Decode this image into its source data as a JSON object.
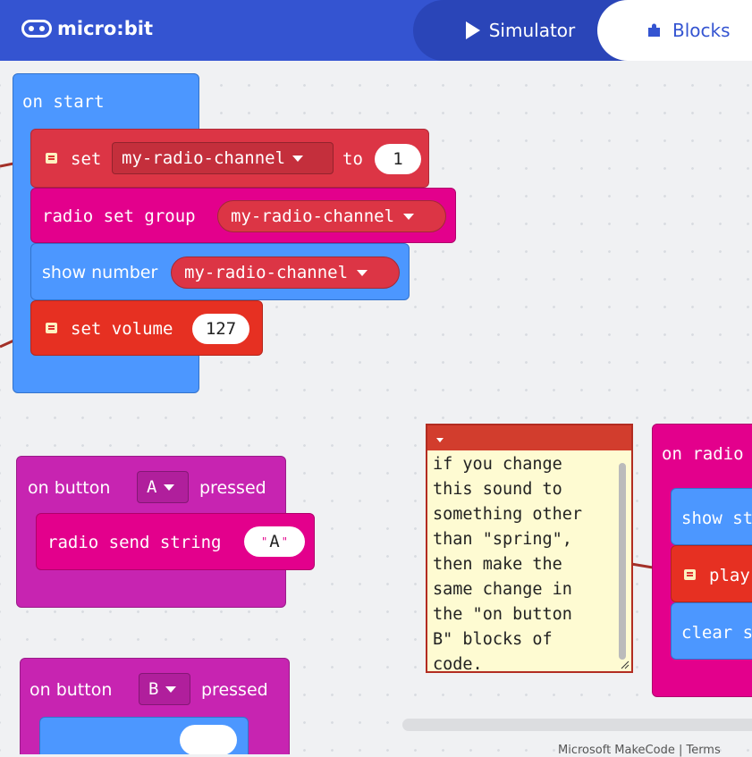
{
  "header": {
    "logo_text": "micro:bit",
    "tabs": [
      {
        "label": "Simulator",
        "icon": "play-icon"
      },
      {
        "label": "Blocks",
        "icon": "puzzle-icon"
      }
    ]
  },
  "blocks": {
    "on_start": {
      "label": "on start",
      "set_var": {
        "set": "set",
        "var": "my-radio-channel",
        "to": "to",
        "value": "1"
      },
      "radio_group": {
        "label": "radio set group",
        "var": "my-radio-channel"
      },
      "show_number": {
        "label": "show number",
        "var": "my-radio-channel"
      },
      "set_volume": {
        "label": "set volume",
        "value": "127"
      }
    },
    "button_a": {
      "on": "on button",
      "button": "A",
      "pressed": "pressed",
      "send": {
        "label": "radio send string",
        "value": "A"
      }
    },
    "button_b": {
      "on": "on button",
      "button": "B",
      "pressed": "pressed"
    },
    "radio_event": {
      "label": "on radio",
      "show": "show st",
      "play": "play",
      "clear": "clear s"
    }
  },
  "comment": {
    "text": "if you change\nthis sound to\nsomething other\nthan \"spring\",\nthen make the\nsame change in\nthe \"on button\nB\" blocks of\ncode."
  },
  "footer": {
    "text": "Microsoft MakeCode | Terms"
  },
  "colors": {
    "header": "#3454d1",
    "basic_blue": "#4c97ff",
    "variables_red": "#dc3545",
    "radio_pink": "#e3008c",
    "music_orange": "#e63022",
    "input_purple": "#c724b1"
  }
}
